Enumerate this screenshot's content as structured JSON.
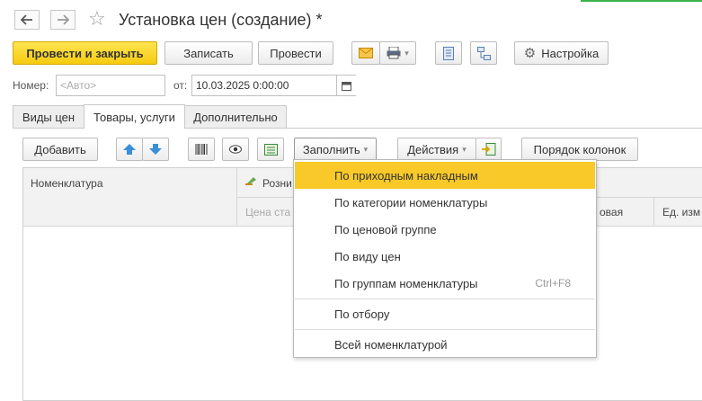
{
  "window": {
    "title": "Установка цен (создание) *"
  },
  "toolbar": {
    "post_close": "Провести и закрыть",
    "save": "Записать",
    "post": "Провести",
    "settings": "Настройка"
  },
  "form": {
    "number_label": "Номер:",
    "number_placeholder": "<Авто>",
    "date_label": "от:",
    "date_value": "10.03.2025  0:00:00"
  },
  "tabs": [
    {
      "label": "Виды цен",
      "active": false
    },
    {
      "label": "Товары, услуги",
      "active": true
    },
    {
      "label": "Дополнительно",
      "active": false
    }
  ],
  "table_toolbar": {
    "add": "Добавить",
    "fill": "Заполнить",
    "actions": "Действия",
    "column_order": "Порядок колонок"
  },
  "table": {
    "col_nomenclature": "Номенклатура",
    "col_retail": "Розни",
    "sub_price": "Цена ста",
    "sub_new": "овая",
    "sub_unit": "Ед. изм"
  },
  "fill_menu": {
    "items": [
      {
        "label": "По приходным накладным",
        "shortcut": "",
        "highlighted": true
      },
      {
        "label": "По категории номенклатуры",
        "shortcut": "",
        "highlighted": false
      },
      {
        "label": "По ценовой группе",
        "shortcut": "",
        "highlighted": false
      },
      {
        "label": "По виду цен",
        "shortcut": "",
        "highlighted": false
      },
      {
        "label": "По группам номенклатуры",
        "shortcut": "Ctrl+F8",
        "highlighted": false
      },
      {
        "label": "По отбору",
        "shortcut": "",
        "highlighted": false
      },
      {
        "label": "Всей номенклатурой",
        "shortcut": "",
        "highlighted": false
      }
    ]
  },
  "colors": {
    "primary": "#f5cb10",
    "highlight": "#f8c928",
    "accent_blue": "#3a8fd8",
    "green": "#3bb34a"
  },
  "icons": [
    "back-arrow-icon",
    "forward-arrow-icon",
    "star-icon",
    "envelope-icon",
    "printer-icon",
    "document-icon",
    "structure-icon",
    "gear-icon",
    "move-up-icon",
    "move-down-icon",
    "barcode-icon",
    "eye-icon",
    "calculator-icon",
    "export-icon",
    "calendar-icon",
    "retail-price-icon"
  ]
}
